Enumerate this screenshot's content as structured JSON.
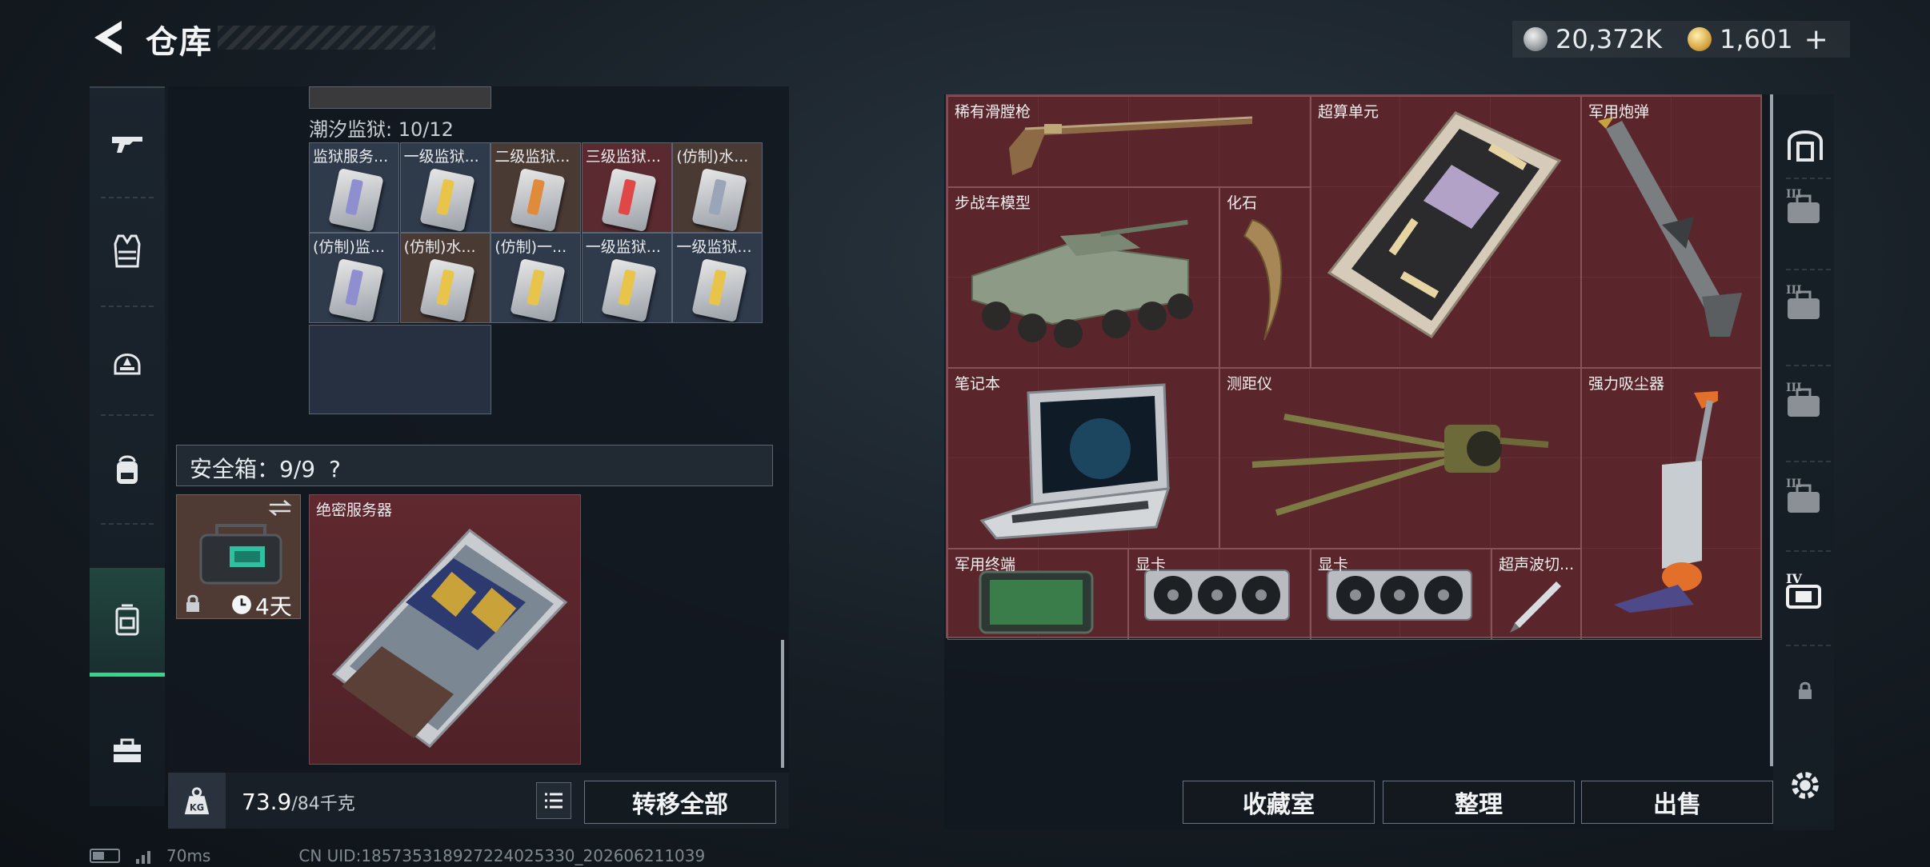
{
  "header": {
    "title": "仓库",
    "currency": [
      {
        "icon": "silver-coin-icon",
        "value": "20,372K"
      },
      {
        "icon": "gold-coin-icon",
        "value": "1,601"
      }
    ],
    "add_symbol": "+"
  },
  "left_nav": {
    "items": [
      {
        "icon": "gun-icon"
      },
      {
        "icon": "vest-icon"
      },
      {
        "icon": "helmet-icon"
      },
      {
        "icon": "backpack-icon"
      },
      {
        "icon": "safe-box-icon",
        "active": true
      },
      {
        "icon": "toolbox-icon"
      }
    ]
  },
  "container": {
    "label": "潮汐监狱: 10/12",
    "cards": [
      {
        "label": "监狱服务...",
        "color": "#2f3a4b",
        "stripe": "#8f8fd0"
      },
      {
        "label": "一级监狱...",
        "color": "#2f3a4b",
        "stripe": "#e8c54a"
      },
      {
        "label": "二级监狱...",
        "color": "#4a3a34",
        "stripe": "#e08a3c"
      },
      {
        "label": "三级监狱...",
        "color": "#5a2a30",
        "stripe": "#e04848"
      },
      {
        "label": "(仿制)水...",
        "color": "#4a3a34",
        "stripe": "#9aa6b8"
      },
      {
        "label": "(仿制)监...",
        "color": "#2f3a4b",
        "stripe": "#8f8fd0"
      },
      {
        "label": "(仿制)水...",
        "color": "#4a3a34",
        "stripe": "#e8c54a"
      },
      {
        "label": "(仿制)一...",
        "color": "#2f3a4b",
        "stripe": "#e8c54a"
      },
      {
        "label": "一级监狱...",
        "color": "#2f3a4b",
        "stripe": "#e8c54a"
      },
      {
        "label": "一级监狱...",
        "color": "#2f3a4b",
        "stripe": "#e8c54a"
      }
    ]
  },
  "safe_box": {
    "label": "安全箱：9/9",
    "help": "?",
    "timer": "4天",
    "item_label": "绝密服务器"
  },
  "bottom": {
    "weight_current": "73.9",
    "weight_max": "/84千克",
    "transfer_all": "转移全部"
  },
  "stash": {
    "items": [
      {
        "name": "稀有滑膛枪",
        "icon": "musket-icon"
      },
      {
        "name": "超算单元",
        "icon": "circuit-board-icon"
      },
      {
        "name": "军用炮弹",
        "icon": "missile-icon"
      },
      {
        "name": "步战车模型",
        "icon": "armored-vehicle-icon"
      },
      {
        "name": "化石",
        "icon": "fossil-claw-icon"
      },
      {
        "name": "笔记本",
        "icon": "laptop-icon"
      },
      {
        "name": "测距仪",
        "icon": "rangefinder-icon"
      },
      {
        "name": "强力吸尘器",
        "icon": "vacuum-icon"
      },
      {
        "name": "军用终端",
        "icon": "terminal-icon"
      },
      {
        "name": "显卡",
        "icon": "gpu-icon"
      },
      {
        "name": "显卡",
        "icon": "gpu-icon"
      },
      {
        "name": "超声波切...",
        "icon": "ultrasonic-cutter-icon"
      }
    ],
    "buttons": {
      "collection": "收藏室",
      "sort": "整理",
      "sell": "出售"
    }
  },
  "right_nav": {
    "items": [
      {
        "icon": "vault-icon"
      },
      {
        "icon": "level-3-case-icon",
        "level": "III"
      },
      {
        "icon": "level-3-case-icon",
        "level": "III"
      },
      {
        "icon": "level-3-case-icon",
        "level": "III"
      },
      {
        "icon": "level-3-case-icon",
        "level": "III"
      },
      {
        "icon": "level-4-case-icon",
        "level": "IV"
      },
      {
        "icon": "lock-icon"
      },
      {
        "icon": "gear-icon"
      }
    ]
  },
  "status": {
    "ping": "70ms",
    "uid": "CN UID:18573531892722402533​0_202606211039"
  }
}
